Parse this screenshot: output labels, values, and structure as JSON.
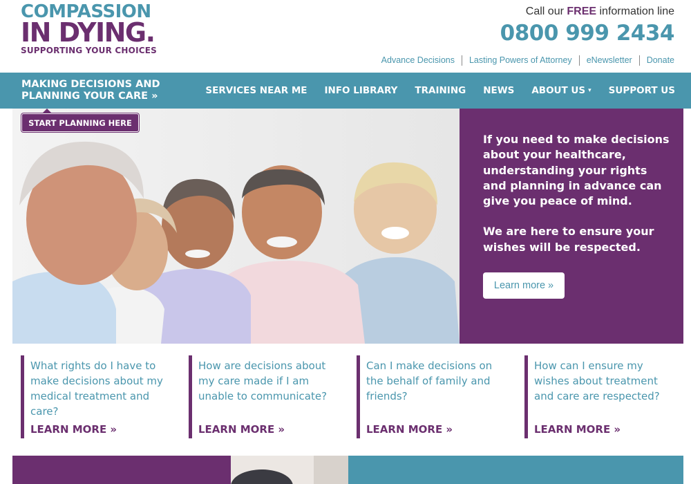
{
  "brand": {
    "line1": "COMPASSION",
    "line2": "IN DYING",
    "line2_dot": ".",
    "tagline": "SUPPORTING YOUR CHOICES"
  },
  "contact": {
    "call_prefix": "Call our ",
    "call_free": "FREE",
    "call_suffix": " information line",
    "phone": "0800 999 2434"
  },
  "top_links": [
    "Advance Decisions",
    "Lasting Powers of Attorney",
    "eNewsletter",
    "Donate"
  ],
  "nav": {
    "cta_line1": "MAKING DECISIONS AND",
    "cta_line2": "PLANNING YOUR CARE »",
    "items": [
      "SERVICES NEAR ME",
      "INFO LIBRARY",
      "TRAINING",
      "NEWS",
      "ABOUT US",
      "SUPPORT US"
    ],
    "about_caret": "▾",
    "plan_button": "START PLANNING HERE"
  },
  "hero": {
    "paragraph1": "If you need to make decisions about your healthcare, understanding your rights and planning in advance can give you peace of mind.",
    "paragraph2": "We are here to ensure your wishes will be respected.",
    "button": "Learn more »"
  },
  "cards": [
    {
      "question": "What rights do I have to make decisions about my medical treatment and care?",
      "link": "LEARN MORE »"
    },
    {
      "question": "How are decisions about my care made if I am unable to communicate?",
      "link": "LEARN MORE »"
    },
    {
      "question": "Can I make decisions on the behalf of family and friends?",
      "link": "LEARN MORE »"
    },
    {
      "question": "How can I ensure my wishes about treatment and care are respected?",
      "link": "LEARN MORE »"
    }
  ],
  "colors": {
    "brand_purple": "#6b2f6f",
    "brand_teal": "#4a96ad"
  },
  "images": {
    "hero_photo": "group-of-smiling-seniors-photo",
    "strip_photo": "person-photo"
  }
}
